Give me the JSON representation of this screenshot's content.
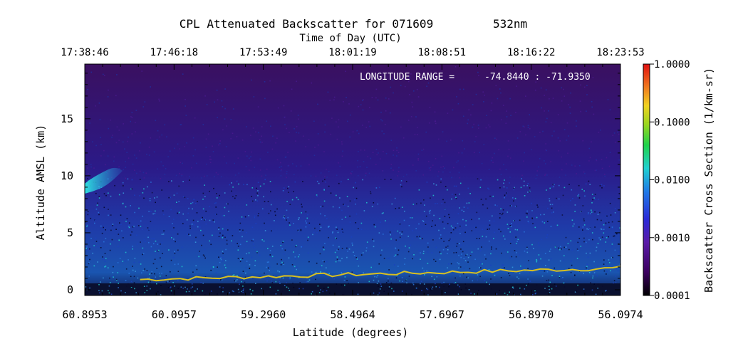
{
  "chart_data": {
    "type": "heatmap",
    "title": "CPL Attenuated Backscatter for 071609",
    "wavelength": "532nm",
    "top_axis_label": "Time of Day (UTC)",
    "time_ticks": [
      "17:38:46",
      "17:46:18",
      "17:53:49",
      "18:01:19",
      "18:08:51",
      "18:16:22",
      "18:23:53"
    ],
    "xlabel": "Latitude (degrees)",
    "x_ticks": [
      "60.8953",
      "60.0957",
      "59.2960",
      "58.4964",
      "57.6967",
      "56.8970",
      "56.0974"
    ],
    "xlim": [
      60.8953,
      56.0974
    ],
    "ylabel": "Altitude AMSL (km)",
    "y_ticks": [
      0,
      5,
      10,
      15
    ],
    "ylim": [
      -0.5,
      19.8
    ],
    "longitude_label": "LONGITUDE RANGE =",
    "longitude_range": "-74.8440 :  -71.9350",
    "colorbar": {
      "label": "Backscatter Cross Section (1/km-sr)",
      "scale": "log",
      "tick_labels": [
        "1.0000",
        "0.1000",
        "0.0100",
        "0.0010",
        "0.0001"
      ],
      "range": [
        0.0001,
        1.0
      ]
    },
    "features": [
      {
        "kind": "boundary-layer-top",
        "lat_start": 60.4,
        "lat_end": 56.0974,
        "altitude_km_start": 0.9,
        "altitude_km_end": 1.9
      },
      {
        "kind": "cloud",
        "lat_start": 60.8953,
        "lat_end": 60.55,
        "altitude_km_min": 8.8,
        "altitude_km_max": 10.7
      }
    ]
  }
}
